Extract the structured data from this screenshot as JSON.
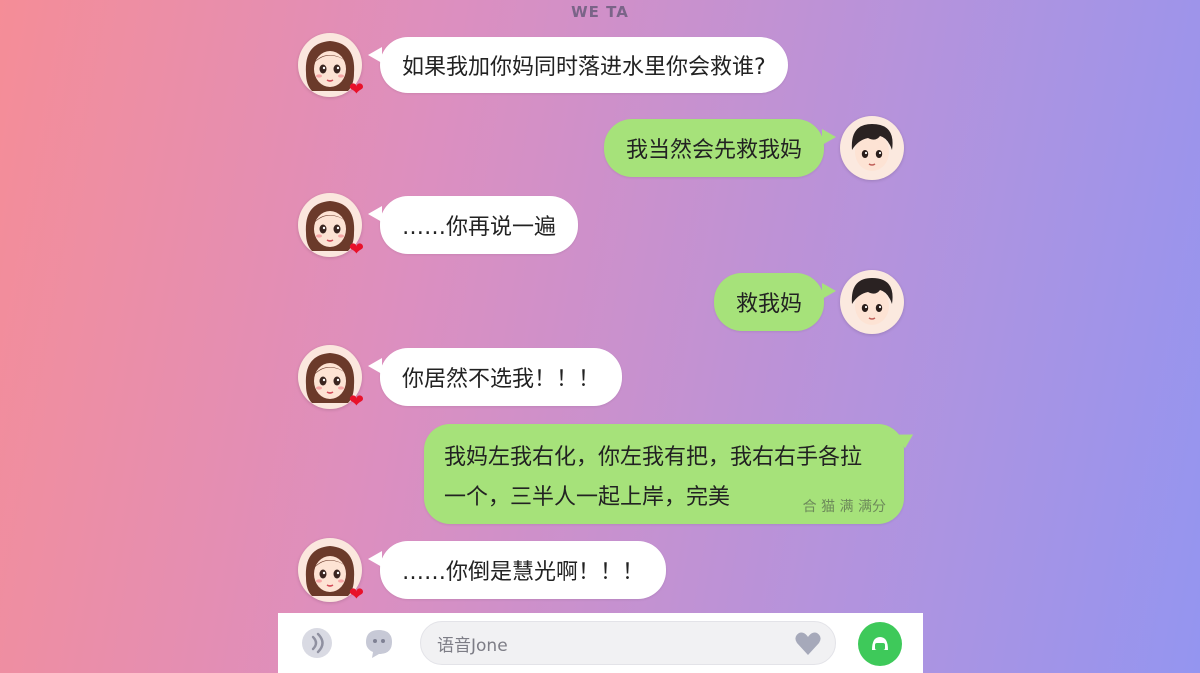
{
  "app": {
    "title": "WE TA"
  },
  "messages": [
    {
      "side": "left",
      "sender": "girl",
      "text": "如果我加你妈同时落进水里你会救谁?"
    },
    {
      "side": "right",
      "sender": "boy",
      "text": "我当然会先救我妈"
    },
    {
      "side": "left",
      "sender": "girl",
      "text": "……你再说一遍"
    },
    {
      "side": "right",
      "sender": "boy",
      "text": "救我妈"
    },
    {
      "side": "left",
      "sender": "girl",
      "text": "你居然不选我！！！"
    },
    {
      "side": "right",
      "sender": "boy",
      "text": "我妈左我右化，你左我有把，我右右手各拉一个，三半人一起上岸，完美",
      "meta": "合 猫 满 满分"
    },
    {
      "side": "left",
      "sender": "girl",
      "text": "……你倒是慧光啊！！！"
    }
  ],
  "input_bar": {
    "placeholder": "语音Jone",
    "icons": {
      "voice": "voice-icon",
      "sticker": "sticker-icon",
      "emoji": "heart-emoji-icon",
      "send": "send-icon"
    },
    "send_color": "#3ec95a"
  },
  "colors": {
    "incoming_bubble": "#ffffff",
    "outgoing_bubble": "#a6e27a",
    "heart": "#e8112a"
  }
}
